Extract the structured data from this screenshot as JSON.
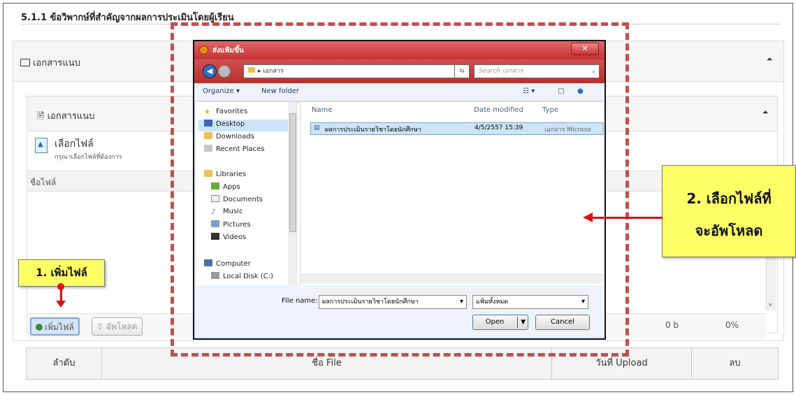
{
  "section_title": "5.1.1 ข้อวิพากษ์ที่สำคัญจากผลการประเมินโดยผู้เรียน",
  "outer_panel": {
    "title": "เอกสารแนบ",
    "collapse": "🞁"
  },
  "inner_panel": {
    "title": "เอกสารแนบ",
    "collapse": "🞁"
  },
  "choose_file": {
    "title": "เลือกไฟล์",
    "hint": "กรุณาเลือกไฟล์ที่ต้องการ"
  },
  "file_name_header": "ชื่อไฟล์",
  "buttons": {
    "add_file": "เพิ่มไฟล์",
    "upload": "อัพโหลด"
  },
  "upload_status": {
    "size": "0 b",
    "percent": "0%"
  },
  "table": {
    "columns": [
      "ลำดับ",
      "ชื่อ File",
      "วันที่ Upload",
      "ลบ"
    ]
  },
  "dialog": {
    "title": "ส่งแฟ้มขึ้น",
    "path": "เอกสาร",
    "search_placeholder": "Search เอกสาร",
    "organize": "Organize ▾",
    "new_folder": "New folder",
    "nav": {
      "favorites": "Favorites",
      "desktop": "Desktop",
      "downloads": "Downloads",
      "recent": "Recent Places",
      "libraries": "Libraries",
      "apps": "Apps",
      "documents": "Documents",
      "music": "Music",
      "pictures": "Pictures",
      "videos": "Videos",
      "computer": "Computer",
      "local_disk": "Local Disk (C:)"
    },
    "columns": {
      "name": "Name",
      "date": "Date modified",
      "type": "Type"
    },
    "file": {
      "name": "ผลการประเมินรายวิชาโดยนักศึกษา",
      "date": "4/5/2557 15:39",
      "type": "เอกสาร Microso"
    },
    "file_name_label": "File name:",
    "file_name_value": "ผลการประเมินรายวิชาโดยนักศึกษา",
    "file_type_value": "แฟ้มทั้งหมด",
    "open": "Open",
    "cancel": "Cancel"
  },
  "annotations": {
    "step1": "1. เพิ่มไฟล์",
    "step2_line1": "2. เลือกไฟล์ที่",
    "step2_line2": "จะอัพโหลด"
  },
  "colors": {
    "highlight_dash": "#c0504d",
    "callout_bg": "#ffff66",
    "arrow": "#e01010"
  }
}
